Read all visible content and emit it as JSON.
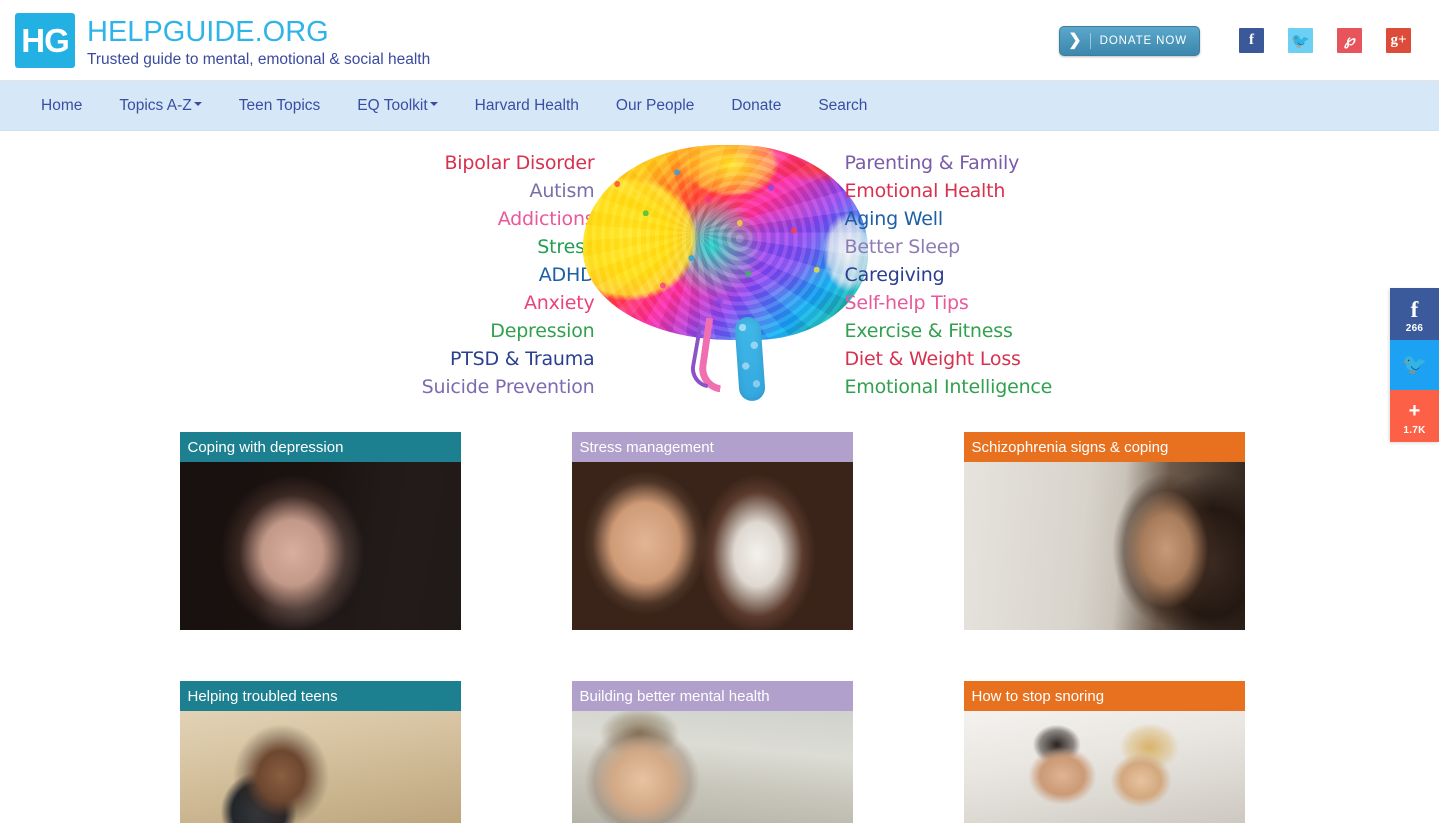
{
  "header": {
    "logo_mark": "HG",
    "logo_icon": "hg-logo-icon",
    "site_title": "HELPGUIDE.ORG",
    "tagline": "Trusted guide to mental, emotional & social health",
    "donate": {
      "label": "DONATE NOW",
      "chevron": "❯"
    },
    "social": [
      {
        "name": "facebook-icon",
        "glyph": "f",
        "color": "#3b5998"
      },
      {
        "name": "twitter-icon",
        "glyph": "🐦",
        "color": "#6cd0f5"
      },
      {
        "name": "pinterest-icon",
        "glyph": "℘",
        "color": "#e8545b"
      },
      {
        "name": "googleplus-icon",
        "glyph": "g+",
        "color": "#dd4b39"
      }
    ]
  },
  "nav": {
    "background": "#d6e8f8",
    "text_color": "#3a4da2",
    "items": [
      {
        "label": "Home",
        "dropdown": false
      },
      {
        "label": "Topics A-Z",
        "dropdown": true
      },
      {
        "label": "Teen Topics",
        "dropdown": false
      },
      {
        "label": "EQ Toolkit",
        "dropdown": true
      },
      {
        "label": "Harvard Health",
        "dropdown": false
      },
      {
        "label": "Our People",
        "dropdown": false
      },
      {
        "label": "Donate",
        "dropdown": false
      },
      {
        "label": "Search",
        "dropdown": false
      }
    ]
  },
  "hero": {
    "image_name": "colorful-rubber-band-brain-illustration",
    "topics_left": [
      {
        "label": "Bipolar Disorder",
        "color": "#d8314f"
      },
      {
        "label": "Autism",
        "color": "#7a6fa8"
      },
      {
        "label": "Addictions",
        "color": "#e8589b"
      },
      {
        "label": "Stress",
        "color": "#239e4e"
      },
      {
        "label": "ADHD",
        "color": "#1d5fa4"
      },
      {
        "label": "Anxiety",
        "color": "#e8437e"
      },
      {
        "label": "Depression",
        "color": "#31a04f"
      },
      {
        "label": "PTSD & Trauma",
        "color": "#2b3f8f"
      },
      {
        "label": "Suicide Prevention",
        "color": "#7d6bb0"
      }
    ],
    "topics_right": [
      {
        "label": "Parenting & Family",
        "color": "#7a5ba8"
      },
      {
        "label": "Emotional Health",
        "color": "#d8314f"
      },
      {
        "label": "Aging Well",
        "color": "#1d5fa4"
      },
      {
        "label": "Better Sleep",
        "color": "#8d7bb5"
      },
      {
        "label": "Caregiving",
        "color": "#2b3f8f"
      },
      {
        "label": "Self-help Tips",
        "color": "#e8589b"
      },
      {
        "label": "Exercise & Fitness",
        "color": "#31a04f"
      },
      {
        "label": "Diet & Weight Loss",
        "color": "#d8314f"
      },
      {
        "label": "Emotional Intelligence",
        "color": "#31a04f"
      }
    ]
  },
  "cards": {
    "rows": [
      [
        {
          "title": "Coping with depression",
          "bar_color": "#1d8091",
          "photo": "ph-depression",
          "photo_name": "woman-at-window-photo"
        },
        {
          "title": "Stress management",
          "bar_color": "#b1a0cc",
          "photo": "ph-stress",
          "photo_name": "man-with-dog-photo"
        },
        {
          "title": "Schizophrenia signs & coping",
          "bar_color": "#e8711f",
          "photo": "ph-schizo",
          "photo_name": "woman-against-wall-photo"
        }
      ],
      [
        {
          "title": "Helping troubled teens",
          "bar_color": "#1d8091",
          "photo": "ph-teens",
          "photo_name": "teen-on-steps-photo"
        },
        {
          "title": "Building better mental health",
          "bar_color": "#b1a0cc",
          "photo": "ph-mental",
          "photo_name": "man-portrait-photo"
        },
        {
          "title": "How to stop snoring",
          "bar_color": "#e8711f",
          "photo": "ph-snoring",
          "photo_name": "couple-in-bed-photo"
        }
      ]
    ]
  },
  "share_bar": {
    "buttons": [
      {
        "name": "share-facebook-button",
        "glyph": "f",
        "count": "266",
        "color": "#3b5a9b"
      },
      {
        "name": "share-twitter-button",
        "glyph": "🐦",
        "count": "",
        "color": "#1da1f2"
      },
      {
        "name": "share-more-button",
        "glyph": "+",
        "count": "1.7K",
        "color": "#fc6148"
      }
    ]
  }
}
